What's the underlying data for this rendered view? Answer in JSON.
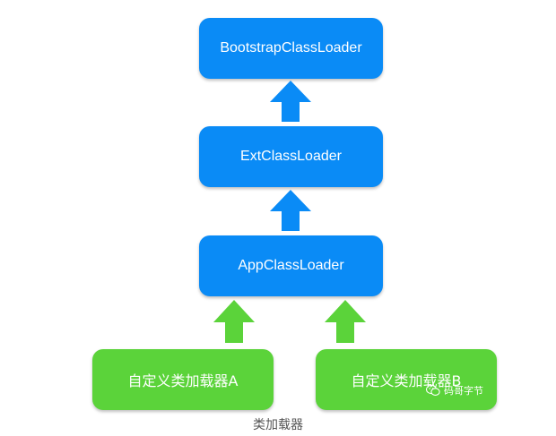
{
  "nodes": {
    "bootstrap": "BootstrapClassLoader",
    "ext": "ExtClassLoader",
    "app": "AppClassLoader",
    "custom_a": "自定义类加载器A",
    "custom_b": "自定义类加载器B"
  },
  "caption": "类加载器",
  "watermark": {
    "icon": "wechat-icon",
    "text": "码哥字节"
  },
  "colors": {
    "blue": "#0a8bf6",
    "green": "#5bd33a"
  }
}
